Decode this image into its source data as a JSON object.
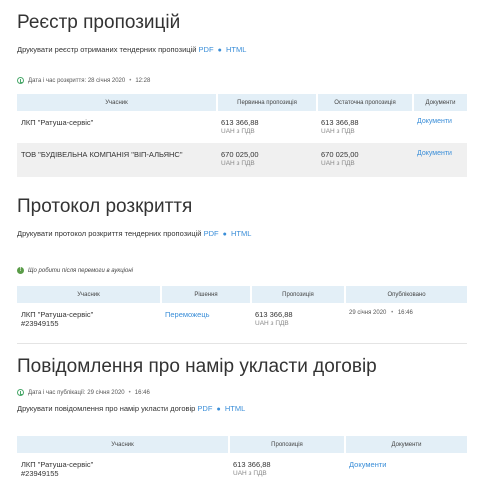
{
  "s1": {
    "title": "Реєстр пропозицій",
    "print_text": "Друкувати реєстр отриманих тендерних пропозицій",
    "pdf": "PDF",
    "html": "HTML",
    "dot": "●",
    "date": "Дата і час розкриття: 28 січня 2020",
    "sep": "•",
    "time": "12:28",
    "headers": [
      "Учасник",
      "Первинна пропозиція",
      "Остаточна пропозиція",
      "Документи"
    ],
    "rows": [
      {
        "name": "ЛКП \"Ратуша-сервіс\"",
        "first": "613 366,88",
        "first_sub": "UAH з ПДВ",
        "last": "613 366,88",
        "last_sub": "UAH з ПДВ",
        "docs": "Документи"
      },
      {
        "name": "ТОВ \"БУДІВЕЛЬНА КОМПАНІЯ \"ВІП-АЛЬЯНС\"",
        "first": "670 025,00",
        "first_sub": "UAH з ПДВ",
        "last": "670 025,00",
        "last_sub": "UAH з ПДВ",
        "docs": "Документи"
      }
    ]
  },
  "s2": {
    "title": "Протокол розкриття",
    "print_text": "Друкувати протокол розкриття тендерних пропозицій",
    "pdf": "PDF",
    "html": "HTML",
    "dot": "●",
    "hint": "Що робити після перемоги в аукціоні",
    "info_icon": "!",
    "headers": [
      "Учасник",
      "Рішення",
      "Пропозиція",
      "Опубліковано"
    ],
    "row": {
      "name": "ЛКП \"Ратуша-сервіс\"",
      "code": "#23949155",
      "decision": "Переможець",
      "offer": "613 366,88",
      "offer_sub": "UAH з ПДВ",
      "published": "29 січня 2020",
      "sep": "•",
      "published_time": "16:46"
    }
  },
  "s3": {
    "title": "Повідомлення про намір укласти договір",
    "date": "Дата і час публікації: 29 січня 2020",
    "sep": "•",
    "time": "16:46",
    "print_text": "Друкувати повідомлення про намір укласти договір",
    "pdf": "PDF",
    "html": "HTML",
    "dot": "●",
    "headers": [
      "Учасник",
      "Пропозиція",
      "Документи"
    ],
    "row": {
      "name": "ЛКП \"Ратуша-сервіс\"",
      "code": "#23949155",
      "offer": "613 366,88",
      "offer_sub": "UAH з ПДВ",
      "docs": "Документи"
    }
  }
}
